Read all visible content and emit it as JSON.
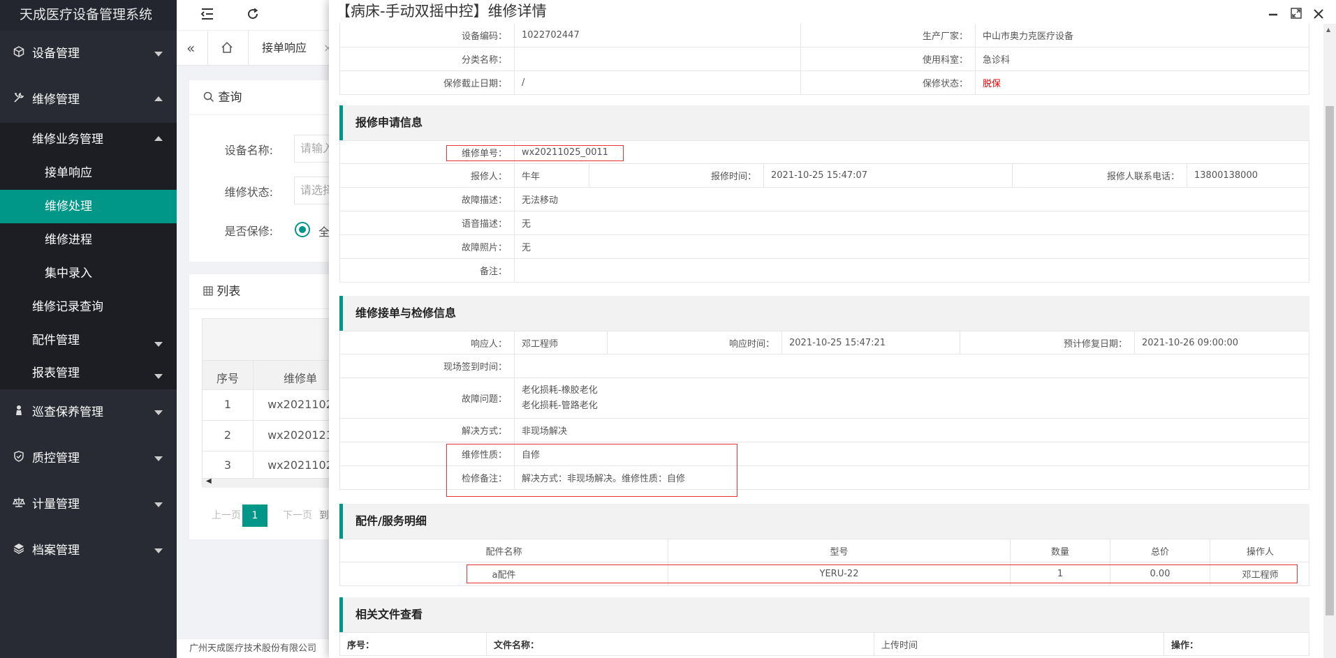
{
  "app": {
    "title": "天成医疗设备管理系统"
  },
  "sidebar": {
    "device_mgmt": "设备管理",
    "repair_mgmt": "维修管理",
    "repair_business": "维修业务管理",
    "leaf_order_response": "接单响应",
    "leaf_repair_handle": "维修处理",
    "leaf_repair_progress": "维修进程",
    "leaf_bulk_entry": "集中录入",
    "repair_record_query": "维修记录查询",
    "parts_mgmt": "配件管理",
    "report_mgmt": "报表管理",
    "inspection_mgmt": "巡查保养管理",
    "qc_mgmt": "质控管理",
    "metrology_mgmt": "计量管理",
    "archive_mgmt": "档案管理"
  },
  "tabs": {
    "current": "接单响应"
  },
  "query": {
    "title": "查询",
    "device_name_label": "设备名称:",
    "device_name_placeholder": "请输入",
    "status_label": "维修状态:",
    "status_placeholder": "请选择",
    "warranty_label": "是否保修:",
    "warranty_option": "全"
  },
  "list": {
    "title": "列表",
    "col_index": "序号",
    "col_order": "维修单",
    "rows": [
      {
        "index": "1",
        "order": "wx2021102"
      },
      {
        "index": "2",
        "order": "wx2020121"
      },
      {
        "index": "3",
        "order": "wx2021102"
      }
    ],
    "prev": "上一页",
    "page": "1",
    "next": "下一页",
    "more": "到"
  },
  "footer": {
    "text": "广州天成医疗技术股份有限公司"
  },
  "modal": {
    "title": "【病床-手动双摇中控】维修详情",
    "device_code_label": "设备编码：",
    "device_code": "1022702447",
    "manufacturer_label": "生产厂家：",
    "manufacturer": "中山市奥力克医疗设备",
    "category_label": "分类名称：",
    "category": "",
    "dept_label": "使用科室：",
    "dept": "急诊科",
    "warranty_end_label": "保修截止日期：",
    "warranty_end": "/",
    "warranty_status_label": "保修状态：",
    "warranty_status": "脱保",
    "sec_apply": "报修申请信息",
    "order_no_label": "维修单号：",
    "order_no": "wx20211025_0011",
    "reporter_label": "报修人：",
    "reporter": "牛年",
    "report_time_label": "报修时间：",
    "report_time": "2021-10-25 15:47:07",
    "reporter_phone_label": "报修人联系电话：",
    "reporter_phone": "13800138000",
    "fault_desc_label": "故障描述：",
    "fault_desc": "无法移动",
    "voice_desc_label": "语音描述：",
    "voice_desc": "无",
    "fault_photo_label": "故障照片：",
    "fault_photo": "无",
    "remark_label": "备注：",
    "remark": "",
    "sec_accept": "维修接单与检修信息",
    "responder_label": "响应人：",
    "responder": "邓工程师",
    "response_time_label": "响应时间：",
    "response_time": "2021-10-25 15:47:21",
    "expected_fix_label": "预计修复日期：",
    "expected_fix": "2021-10-26 09:00:00",
    "signin_time_label": "现场签到时间：",
    "signin_time": "",
    "fault_issue_label": "故障问题：",
    "fault_issue_1": "老化损耗-橡胶老化",
    "fault_issue_2": "老化损耗-管路老化",
    "solution_label": "解决方式：",
    "solution": "非现场解决",
    "repair_nature_label": "维修性质：",
    "repair_nature": "自修",
    "inspect_remark_label": "检修备注：",
    "inspect_remark": "解决方式：非现场解决。维修性质：自修",
    "sec_parts": "配件/服务明细",
    "parts_headers": {
      "name": "配件名称",
      "model": "型号",
      "qty": "数量",
      "total": "总价",
      "operator": "操作人"
    },
    "parts_rows": [
      {
        "name": "a配件",
        "model": "YERU-22",
        "qty": "1",
        "total": "0.00",
        "operator": "邓工程师"
      }
    ],
    "sec_files": "相关文件查看",
    "files_headers": {
      "index": "序号：",
      "name": "文件名称：",
      "upload_time": "上传时间",
      "action": "操作："
    }
  },
  "colors": {
    "accent": "#009688",
    "sidebar": "#282b33",
    "sidebar_sub": "#1c1e24",
    "highlight": "#e43232"
  },
  "icons": {
    "device": "cube-icon",
    "repair": "tools-icon",
    "inspection": "person-icon",
    "qc": "shield-check-icon",
    "metrology": "scale-icon",
    "archive": "layers-icon"
  }
}
